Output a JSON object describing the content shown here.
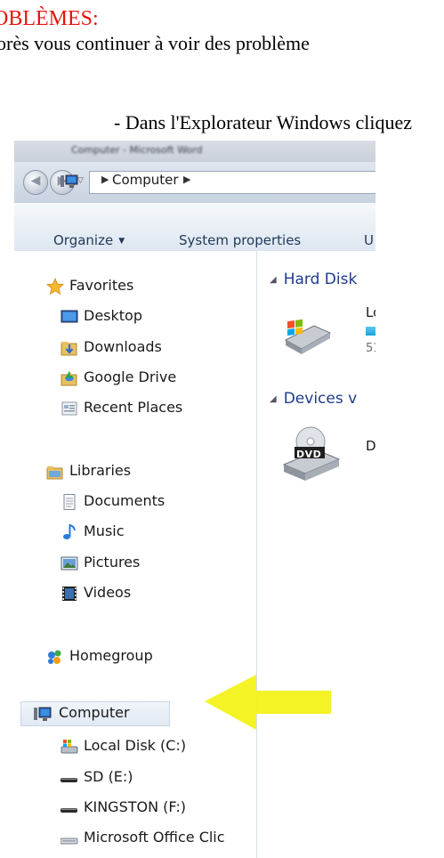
{
  "document": {
    "heading": "OBLÈMES:",
    "line1": "orès vous continuer à voir des problème",
    "bullet": "- Dans l'Explorateur Windows cliquez"
  },
  "explorer": {
    "title": "Computer - Microsoft Word",
    "address": {
      "path_item": "Computer"
    },
    "toolbar": {
      "organize": "Organize",
      "system_properties": "System properties",
      "truncated": "U"
    },
    "nav_pane": {
      "favorites": {
        "label": "Favorites",
        "items": [
          "Desktop",
          "Downloads",
          "Google Drive",
          "Recent Places"
        ]
      },
      "libraries": {
        "label": "Libraries",
        "items": [
          "Documents",
          "Music",
          "Pictures",
          "Videos"
        ]
      },
      "homegroup": "Homegroup",
      "computer": {
        "label": "Computer",
        "items": [
          "Local Disk (C:)",
          "SD (E:)",
          "KINGSTON (F:)",
          "Microsoft Office Clic"
        ]
      }
    },
    "content": {
      "group1": "Hard Disk",
      "drive1_name": "Lo",
      "drive1_size": "51",
      "group2": "Devices v",
      "drive2_name": "D'",
      "dvd_badge": "DVD"
    },
    "annotation": {
      "arrow_color": "#f2f21a"
    }
  }
}
